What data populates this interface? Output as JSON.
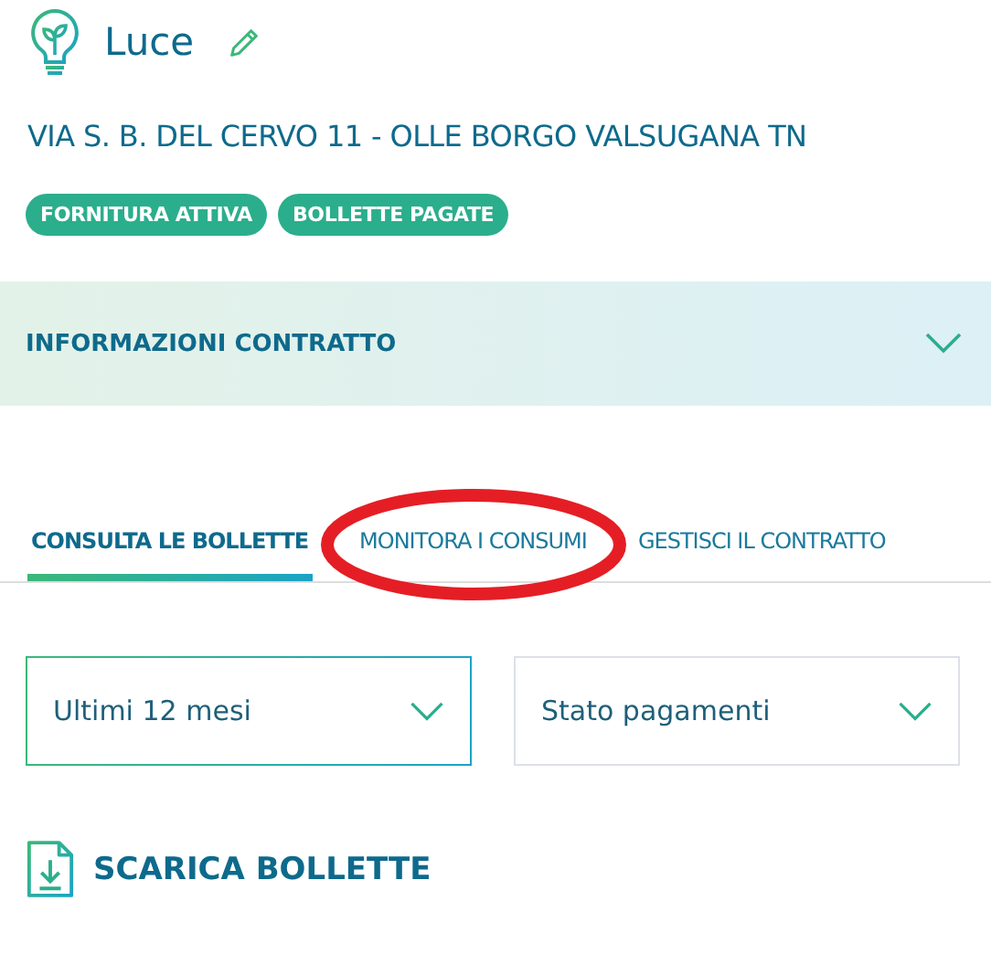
{
  "supply": {
    "title": "Luce",
    "address": "VIA S. B. DEL CERVO 11 - OLLE BORGO VALSUGANA TN"
  },
  "badges": [
    "FORNITURA ATTIVA",
    "BOLLETTE PAGATE"
  ],
  "contract_info": {
    "label": "INFORMAZIONI CONTRATTO",
    "expanded": false
  },
  "tabs": [
    {
      "label": "CONSULTA LE BOLLETTE",
      "selected": true,
      "circled": false
    },
    {
      "label": "MONITORA I CONSUMI",
      "selected": false,
      "circled": true
    },
    {
      "label": "GESTISCI IL CONTRATTO",
      "selected": false,
      "circled": false
    }
  ],
  "filters": [
    {
      "value": "Ultimi 12 mesi",
      "active": true
    },
    {
      "value": "Stato pagamenti",
      "active": false
    }
  ],
  "download": {
    "label": "SCARICA BOLLETTE"
  }
}
